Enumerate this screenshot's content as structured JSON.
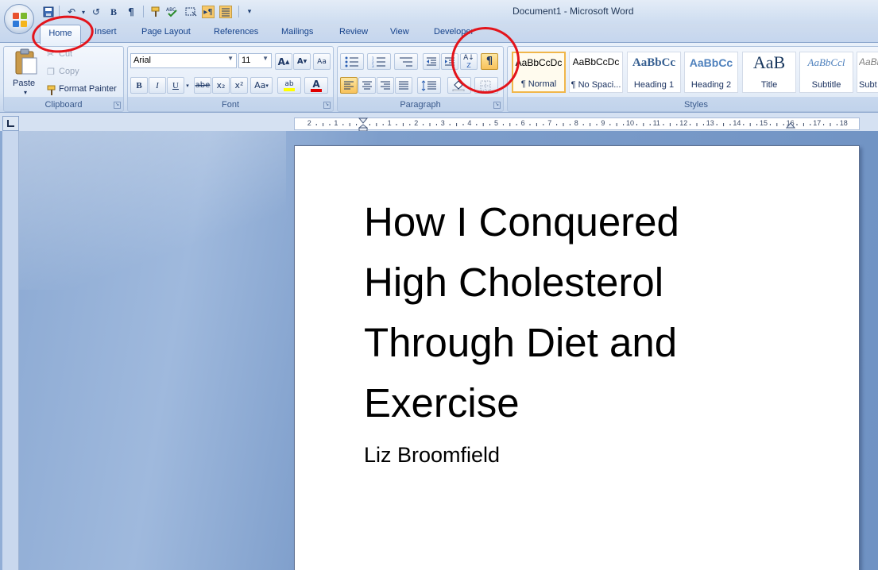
{
  "window": {
    "title": "Document1 - Microsoft Word"
  },
  "quick_access": {
    "icons": [
      "save-icon",
      "undo-icon",
      "redo-icon",
      "bold-icon",
      "pilcrow-icon",
      "format-painter-icon",
      "spelling-icon",
      "select-icon",
      "show-hide-icon",
      "justify-icon",
      "customize-icon"
    ],
    "glyphs": {
      "bold": "B",
      "pilcrow": "¶",
      "undo": "↶",
      "redo": "↺",
      "customize": "▾"
    }
  },
  "tabs": [
    "Home",
    "Insert",
    "Page Layout",
    "References",
    "Mailings",
    "Review",
    "View",
    "Developer"
  ],
  "active_tab": "Home",
  "clipboard": {
    "paste": "Paste",
    "cut": "Cut",
    "copy": "Copy",
    "format_painter": "Format Painter",
    "label": "Clipboard"
  },
  "font": {
    "font_name": "Arial",
    "font_size": "11",
    "label": "Font",
    "grow": "A",
    "shrink": "A",
    "clear": "Aa",
    "bold": "B",
    "italic": "I",
    "underline": "U",
    "strike": "abe",
    "subscript": "x₂",
    "superscript": "x²",
    "change_case": "Aa",
    "highlight_letters": "ab",
    "font_color_letter": "A",
    "highlight_color": "#ffff00",
    "font_color": "#e00000"
  },
  "paragraph": {
    "label": "Paragraph",
    "sort": "A↓",
    "show_hide": "¶"
  },
  "styles": {
    "label": "Styles",
    "items": [
      {
        "sample": "AaBbCcDc",
        "name": "¶ Normal"
      },
      {
        "sample": "AaBbCcDc",
        "name": "¶ No Spaci..."
      },
      {
        "sample": "AaBbCc",
        "name": "Heading 1"
      },
      {
        "sample": "AaBbCc",
        "name": "Heading 2"
      },
      {
        "sample": "AaB",
        "name": "Title"
      },
      {
        "sample": "AaBbCcl",
        "name": "Subtitle"
      },
      {
        "sample": "AaBbC",
        "name": "Subt"
      }
    ]
  },
  "ruler": {
    "numbers": [
      "2",
      "1",
      "1",
      "2",
      "3",
      "4",
      "5",
      "6",
      "7",
      "8",
      "9",
      "10",
      "11",
      "12",
      "13",
      "14",
      "15",
      "16",
      "17",
      "18"
    ]
  },
  "document": {
    "title_lines": [
      "How I Conquered",
      "High Cholesterol",
      "Through Diet and",
      "Exercise"
    ],
    "author": "Liz Broomfield"
  },
  "colors": {
    "annotation": "#e3141b",
    "selected_style_border": "#f0b64a"
  }
}
